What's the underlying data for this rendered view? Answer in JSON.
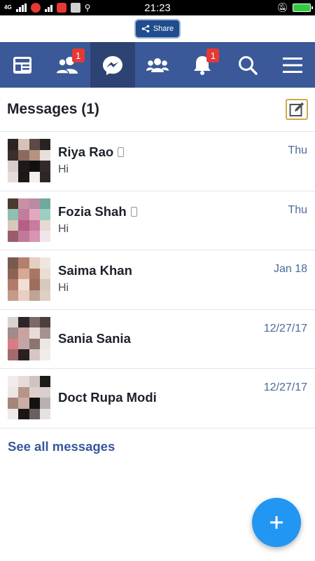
{
  "status_bar": {
    "network": "4G",
    "time": "21:23",
    "app_colors": [
      "#e53935",
      "#e53935",
      "#cfcfcf"
    ]
  },
  "share": {
    "label": "Share",
    "icon": "share-icon"
  },
  "nav": {
    "items": [
      {
        "name": "news-feed",
        "icon": "news-feed-icon",
        "badge": ""
      },
      {
        "name": "friend-requests",
        "icon": "friends-icon",
        "badge": "1"
      },
      {
        "name": "messages",
        "icon": "messenger-icon",
        "badge": "",
        "active": true
      },
      {
        "name": "groups",
        "icon": "groups-icon",
        "badge": ""
      },
      {
        "name": "notifications",
        "icon": "bell-icon",
        "badge": "1"
      },
      {
        "name": "search",
        "icon": "search-icon",
        "badge": ""
      },
      {
        "name": "menu",
        "icon": "menu-icon",
        "badge": ""
      }
    ],
    "colors": {
      "bar": "#3b5998",
      "active": "#2d4373",
      "badge": "#e53935"
    }
  },
  "messages": {
    "title": "Messages (1)",
    "threads": [
      {
        "name": "Riya Rao",
        "snippet": "Hi",
        "time": "Thu",
        "mobile": true
      },
      {
        "name": "Fozia Shah",
        "snippet": "Hi",
        "time": "Thu",
        "mobile": true
      },
      {
        "name": "Saima Khan",
        "snippet": "Hi",
        "time": "Jan 18",
        "mobile": false
      },
      {
        "name": "Sania Sania",
        "snippet": "",
        "time": "12/27/17",
        "mobile": false
      },
      {
        "name": "Doct Rupa Modi",
        "snippet": "",
        "time": "12/27/17",
        "mobile": false
      }
    ],
    "see_all": "See all messages"
  },
  "fab": {
    "label": "+",
    "color": "#2196f3"
  }
}
